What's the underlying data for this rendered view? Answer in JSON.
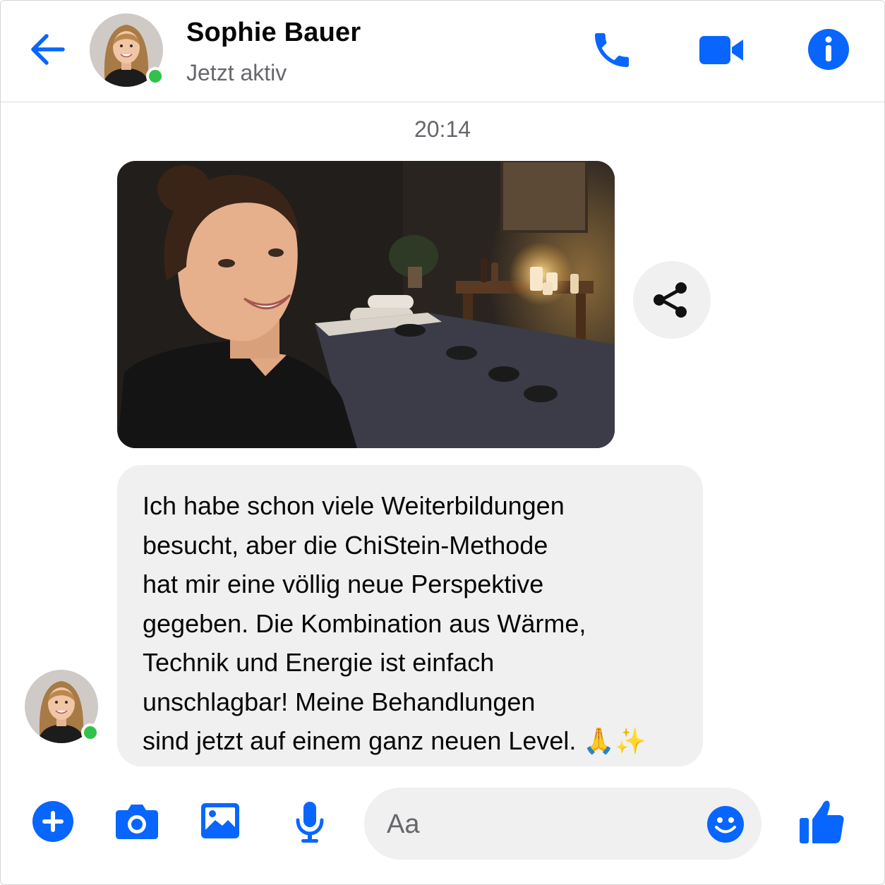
{
  "header": {
    "contact_name": "Sophie Bauer",
    "status": "Jetzt aktiv",
    "icons": [
      "back-arrow-icon",
      "phone-icon",
      "video-call-icon",
      "info-icon"
    ]
  },
  "conversation": {
    "timestamp": "20:14",
    "message_text": "Ich habe schon viele Weiterbildungen\nbesucht, aber die ChiStein-Methode\nhat mir eine völlig neue Perspektive\ngegeben. Die Kombination aus Wärme,\nTechnik und Energie ist einfach\nunschlagbar! Meine Behandlungen\nsind jetzt auf einem ganz neuen Level. 🙏✨"
  },
  "composer": {
    "placeholder": "Aa",
    "icons": [
      "plus-icon",
      "camera-icon",
      "gallery-icon",
      "microphone-icon",
      "emoji-icon",
      "thumbs-up-icon"
    ]
  },
  "colors": {
    "accent": "#0866ff",
    "online": "#31c24a",
    "bubble": "#f0f0f0",
    "secondary_text": "#65676b"
  }
}
